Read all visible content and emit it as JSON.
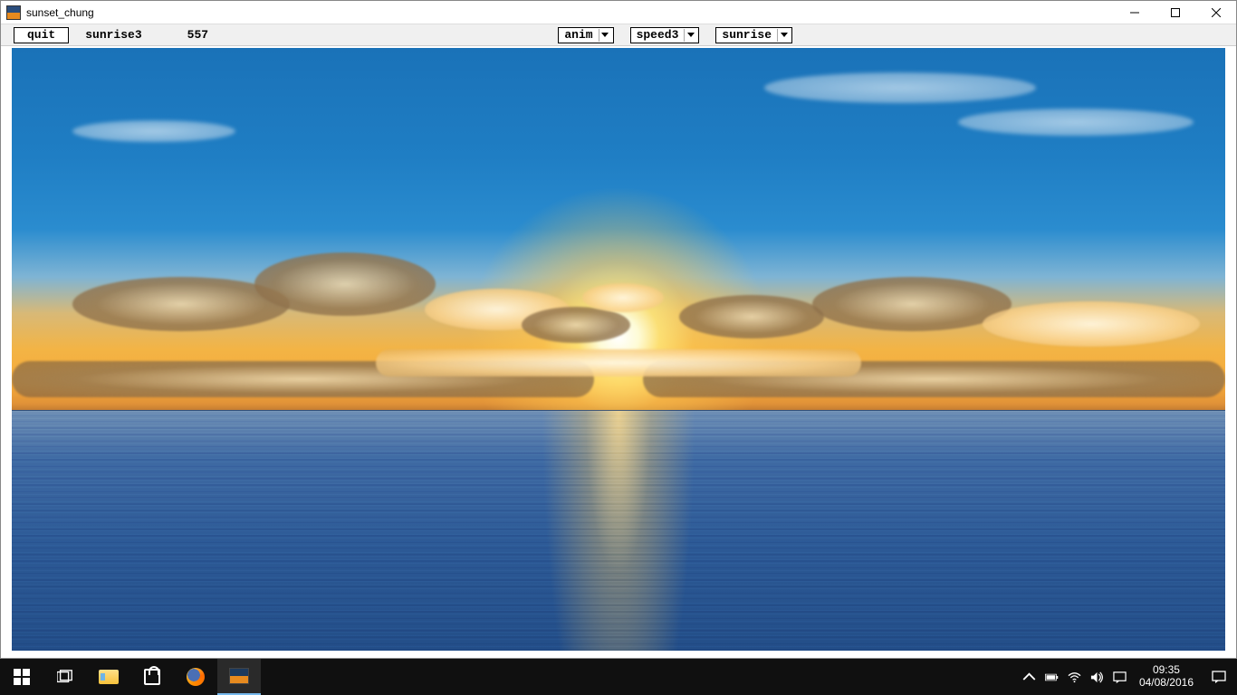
{
  "window": {
    "title": "sunset_chung"
  },
  "toolbar": {
    "quit_label": "quit",
    "mode_label": "sunrise3",
    "frame_number": "557",
    "dropdowns": {
      "anim": "anim",
      "speed": "speed3",
      "scene": "sunrise"
    }
  },
  "taskbar": {
    "clock_time": "09:35",
    "clock_date": "04/08/2016"
  }
}
